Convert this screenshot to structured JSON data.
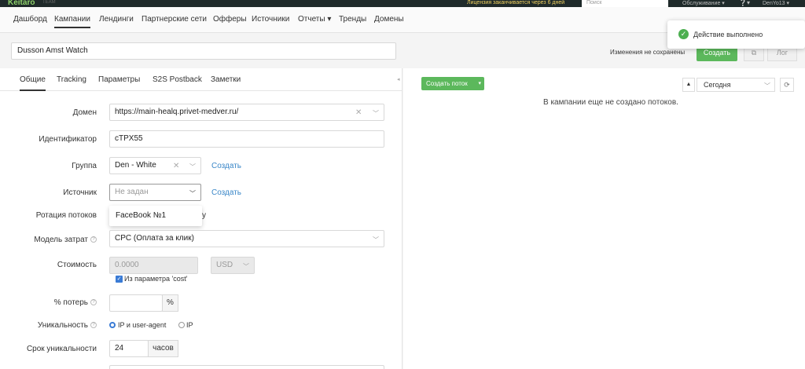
{
  "topbar": {
    "logo": "Keitaro",
    "logo_sub": "TEAM",
    "license": "Лицензия заканчивается через 6 дней",
    "search_placeholder": "Поиск",
    "service": "Обслуживание ▾",
    "help": "❔▾",
    "user": "DenYo13 ▾"
  },
  "nav": {
    "items": [
      "Дашборд",
      "Кампании",
      "Лендинги",
      "Партнерские сети",
      "Офферы",
      "Источники",
      "Отчеты ▾",
      "Тренды",
      "Домены"
    ]
  },
  "campaign": {
    "name": "Dusson Amst Watch",
    "unsaved": "Изменения не сохранены",
    "create_label": "Создать",
    "log_label": "Лог"
  },
  "toast": {
    "text": "Действие выполнено"
  },
  "tabs": [
    "Общие",
    "Tracking",
    "Параметры",
    "S2S Postback",
    "Заметки"
  ],
  "form": {
    "domain_label": "Домен",
    "domain_value": "https://main-healq.privet-medver.ru/",
    "id_label": "Идентификатор",
    "id_value": "cTPX55",
    "group_label": "Группа",
    "group_value": "Den - White",
    "create_link": "Создать",
    "source_label": "Источник",
    "source_placeholder": "Не задан",
    "source_option": "FaceBook №1",
    "rotation_label": "Ротация потоков",
    "rotation_tail": "у",
    "cost_model_label": "Модель затрат",
    "cost_model_value": "CPC (Оплата за клик)",
    "cost_label": "Стоимость",
    "cost_value": "0.0000",
    "currency": "USD",
    "cost_param": "Из параметра 'cost'",
    "loss_label": "% потерь",
    "loss_unit": "%",
    "uniq_label": "Уникальность",
    "uniq_opt1": "IP и user-agent",
    "uniq_opt2": "IP",
    "uniq_term_label": "Срок уникальности",
    "uniq_term_value": "24",
    "uniq_term_unit": "часов"
  },
  "right": {
    "create_flow": "Создать поток",
    "empty": "В кампании еще не создано потоков.",
    "date": "Сегодня"
  }
}
